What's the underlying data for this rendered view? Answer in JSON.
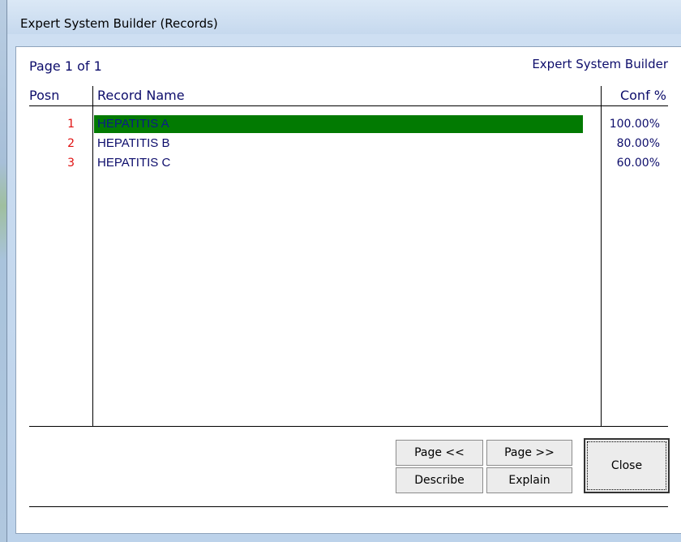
{
  "window": {
    "title": "Expert System Builder (Records)"
  },
  "header": {
    "page_label": "Page 1 of 1",
    "app_label": "Expert System Builder"
  },
  "table": {
    "columns": [
      "Posn",
      "Record Name",
      "Conf %"
    ],
    "rows": [
      {
        "posn": "1",
        "name": "HEPATITIS A",
        "conf": "100.00%",
        "selected": true
      },
      {
        "posn": "2",
        "name": "HEPATITIS B",
        "conf": "80.00%",
        "selected": false
      },
      {
        "posn": "3",
        "name": "HEPATITIS C",
        "conf": "60.00%",
        "selected": false
      }
    ]
  },
  "buttons": {
    "page_prev": "Page <<",
    "page_next": "Page >>",
    "describe": "Describe",
    "explain": "Explain",
    "close": "Close"
  },
  "colors": {
    "text": "#0d0d6b",
    "posn": "#e01010",
    "selected_bg": "#027a02"
  }
}
